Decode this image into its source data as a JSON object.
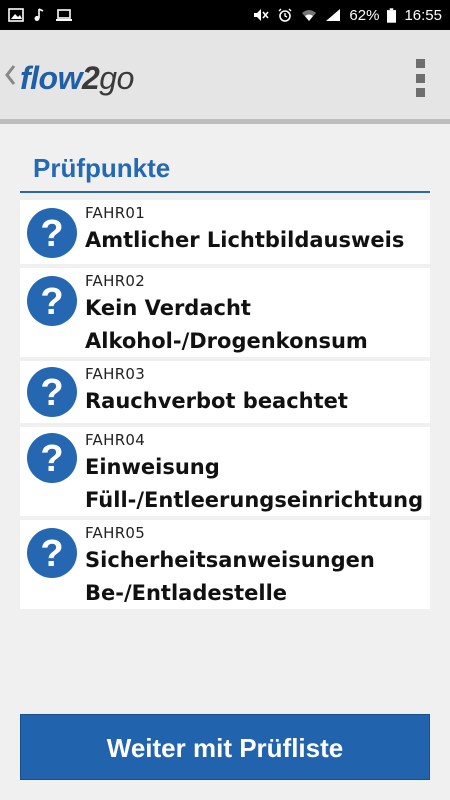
{
  "status_bar": {
    "left_icons": [
      "image-icon",
      "music-note-icon",
      "laptop-icon"
    ],
    "right_icons": [
      "mute-icon",
      "alarm-icon",
      "wifi-icon",
      "signal-icon",
      "battery-icon"
    ],
    "battery_text": "62%",
    "time": "16:55"
  },
  "app_bar": {
    "back_icon": "chevron-left-icon",
    "logo_part1": "flow",
    "logo_part2": "2",
    "logo_part3": "go",
    "menu_icon": "overflow-menu-icon"
  },
  "section": {
    "title": "Prüfpunkte"
  },
  "items": [
    {
      "code": "FAHR01",
      "title_line1": "Amtlicher Lichtbildausweis",
      "title_line2": "",
      "icon": "question-icon"
    },
    {
      "code": "FAHR02",
      "title_line1": "Kein Verdacht",
      "title_line2": "Alkohol-/Drogenkonsum",
      "icon": "question-icon"
    },
    {
      "code": "FAHR03",
      "title_line1": "Rauchverbot beachtet",
      "title_line2": "",
      "icon": "question-icon"
    },
    {
      "code": "FAHR04",
      "title_line1": "Einweisung",
      "title_line2": "Füll-/Entleerungseinrichtung",
      "icon": "question-icon"
    },
    {
      "code": "FAHR05",
      "title_line1": "Sicherheitsanweisungen",
      "title_line2": "Be-/Entladestelle",
      "icon": "question-icon"
    }
  ],
  "cta": {
    "label": "Weiter mit Prüfliste"
  },
  "colors": {
    "accent": "#2263ae",
    "icon_blue": "#2567b1",
    "status_bar": "#000000",
    "app_bar": "#e5e5e5"
  }
}
